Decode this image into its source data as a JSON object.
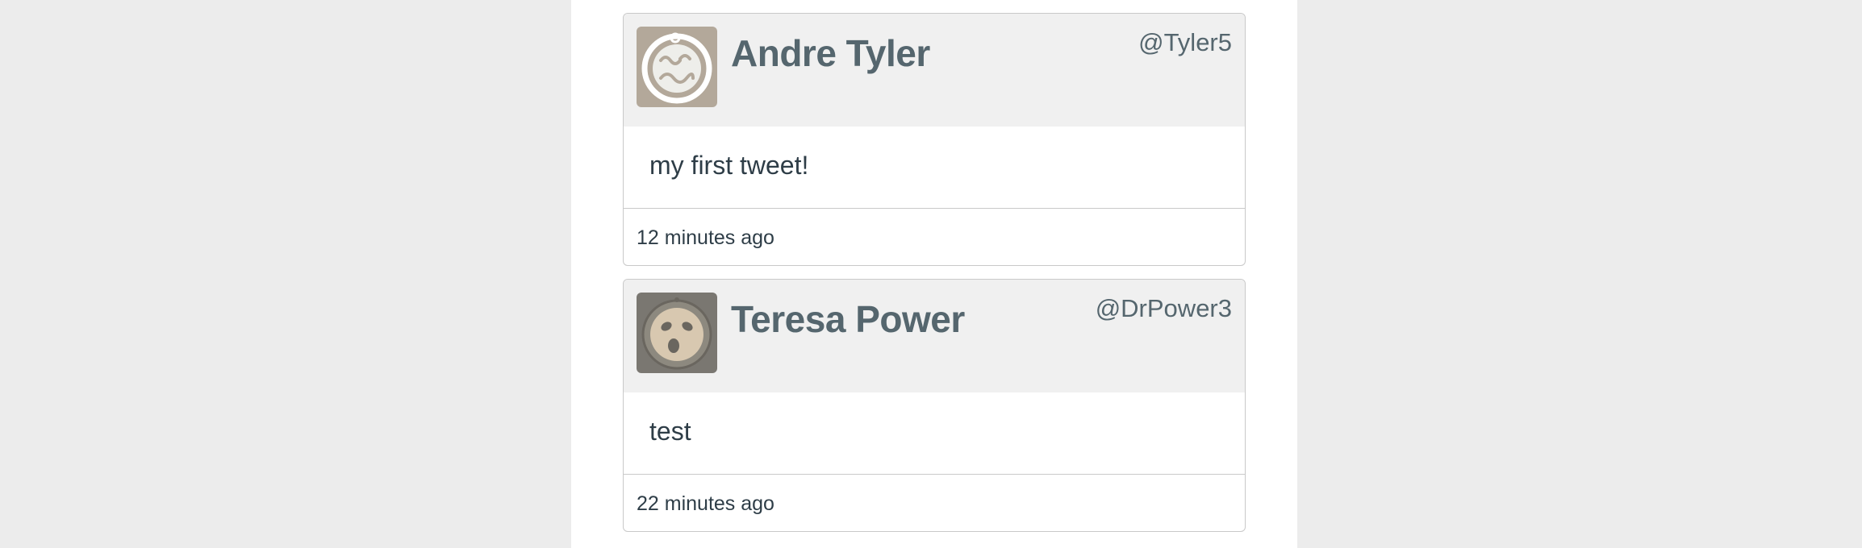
{
  "tweets": [
    {
      "name": "Andre Tyler",
      "handle": "@Tyler5",
      "text": "my first tweet!",
      "time": "12 minutes ago",
      "avatar_icon": "swirl-face-icon",
      "avatar_bg": "#b3a89a"
    },
    {
      "name": "Teresa Power",
      "handle": "@DrPower3",
      "text": "test",
      "time": "22 minutes ago",
      "avatar_icon": "surprised-face-icon",
      "avatar_bg": "#7a7771"
    }
  ],
  "colors": {
    "page_background": "#ececec",
    "header_background": "#f0f0f0",
    "name_color": "#55666e",
    "text_color": "#2e3d47",
    "border": "#c9c9c9"
  }
}
